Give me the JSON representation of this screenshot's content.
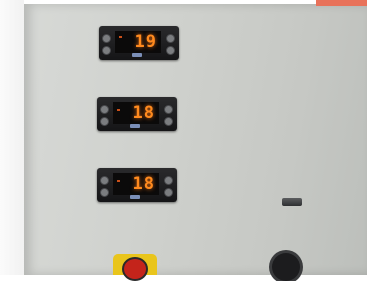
{
  "scene": {
    "subject": "control-panel",
    "controllers": [
      {
        "reading": "19"
      },
      {
        "reading": "18"
      },
      {
        "reading": "18"
      }
    ],
    "colors": {
      "panel": "#cfd1cd",
      "controller_body": "#1c1c1e",
      "display_digits": "#ff8a1e",
      "emergency_stop_ring": "#e9c51c",
      "emergency_stop_knob": "#c4241b"
    }
  }
}
